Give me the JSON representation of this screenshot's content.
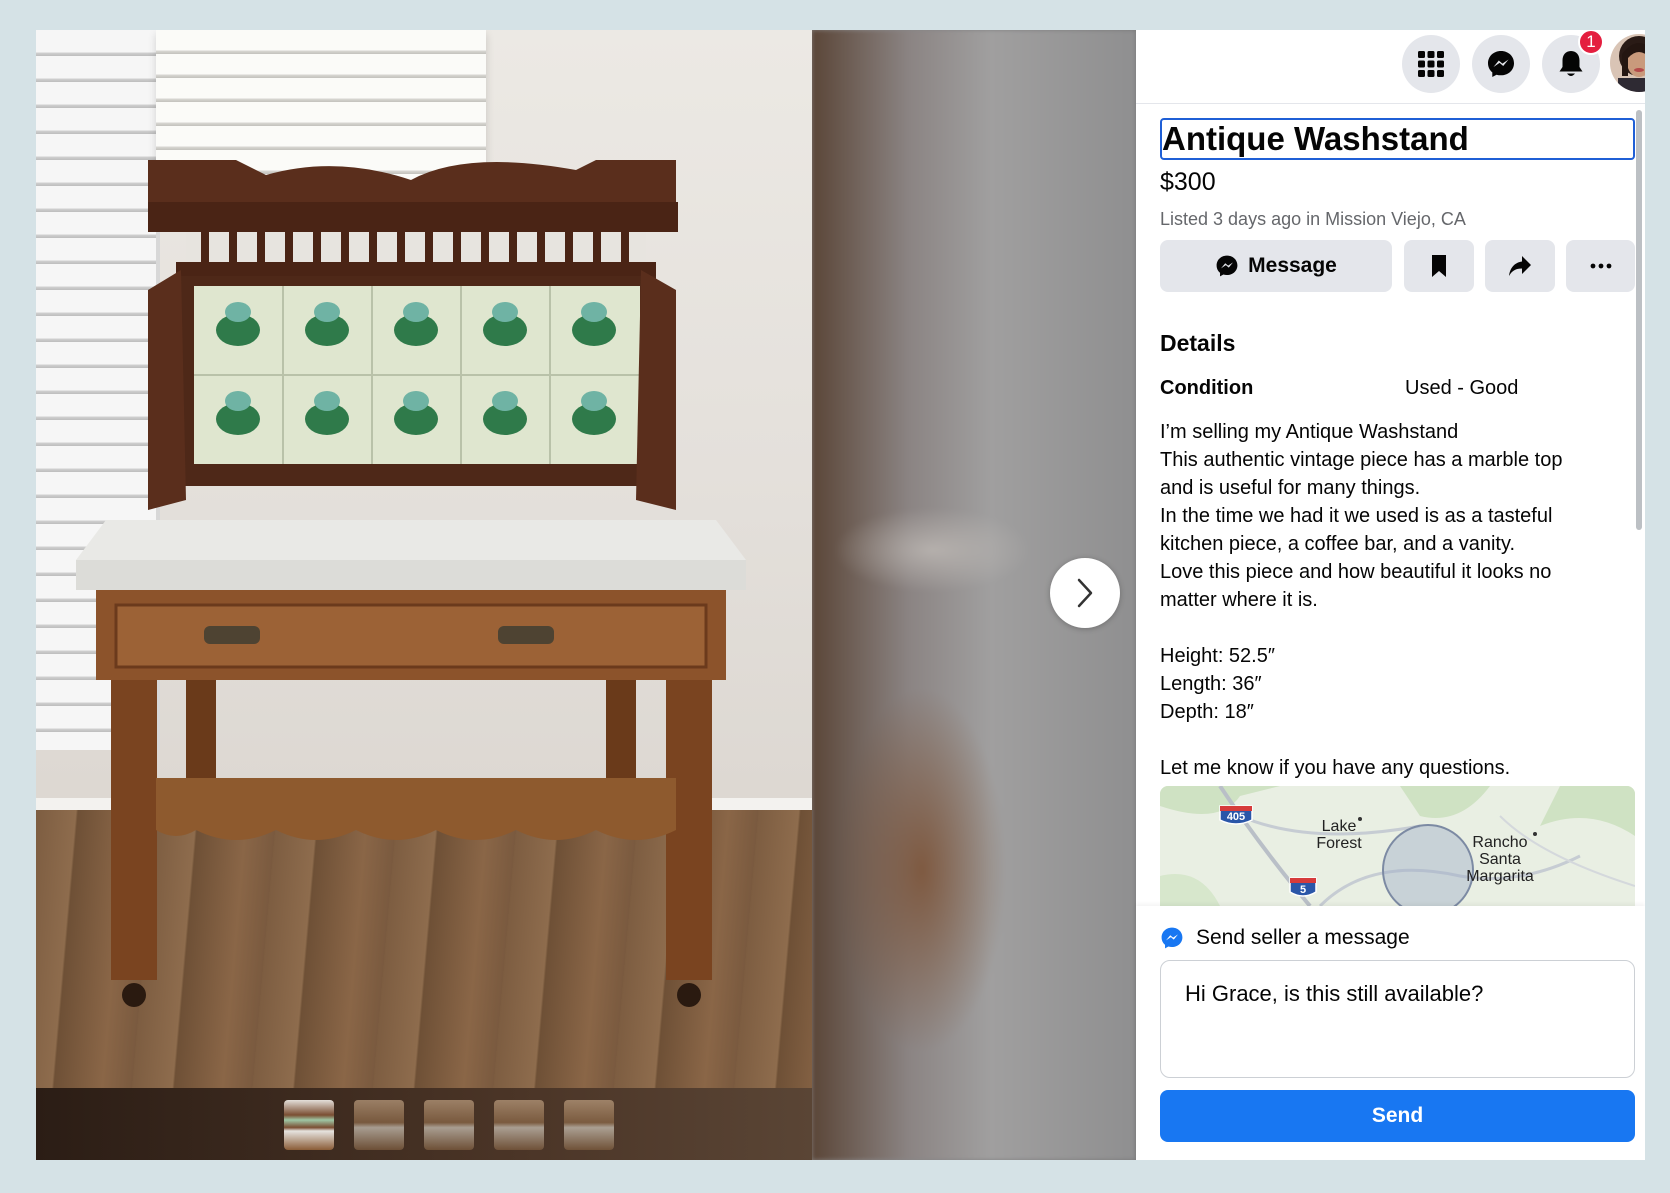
{
  "header": {
    "icons": [
      "grid-menu-icon",
      "messenger-icon",
      "bell-icon"
    ],
    "notification_count": "1"
  },
  "listing": {
    "title": "Antique Washstand",
    "price": "$300",
    "listed": "Listed 3 days ago in Mission Viejo, CA",
    "message_label": "Message",
    "details_heading": "Details",
    "condition_label": "Condition",
    "condition_value": "Used - Good",
    "description": [
      "I’m selling my Antique Washstand",
      "This authentic vintage piece has a marble top",
      "and is useful for many things.",
      "In the time we had it we used is as a tasteful",
      "kitchen piece, a coffee bar, and a vanity.",
      "Love this piece and how beautiful it looks no",
      "matter where it is.",
      "",
      "Height: 52.5″",
      "Length: 36″",
      "Depth: 18″",
      "",
      "Let me know if you have any questions."
    ]
  },
  "map": {
    "labels": [
      "Lake Forest",
      "Rancho Santa Margarita"
    ],
    "highway_shields": [
      "405",
      "5"
    ]
  },
  "send": {
    "title": "Send seller a message",
    "message_value": "Hi Grace, is this still available?",
    "button_label": "Send"
  },
  "gallery": {
    "thumbnail_count": 5,
    "active_index": 0
  }
}
